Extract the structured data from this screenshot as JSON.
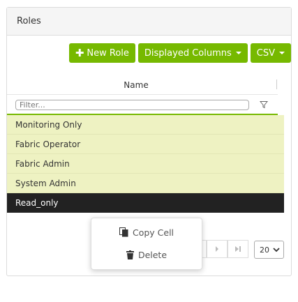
{
  "panel": {
    "title": "Roles"
  },
  "toolbar": {
    "new_role_label": "New Role",
    "columns_label": "Displayed Columns",
    "csv_label": "CSV"
  },
  "table": {
    "column_name": "Name",
    "filter_placeholder": "Filter...",
    "rows": [
      {
        "name": "Monitoring Only"
      },
      {
        "name": "Fabric Operator"
      },
      {
        "name": "Fabric Admin"
      },
      {
        "name": "System Admin"
      },
      {
        "name": "Read_only"
      }
    ]
  },
  "pagination": {
    "page_size": "20"
  },
  "context_menu": {
    "copy_label": "Copy Cell",
    "delete_label": "Delete"
  },
  "colors": {
    "accent": "#76b900",
    "selected_row": "#222222",
    "row_highlight": "#eef2c2"
  }
}
